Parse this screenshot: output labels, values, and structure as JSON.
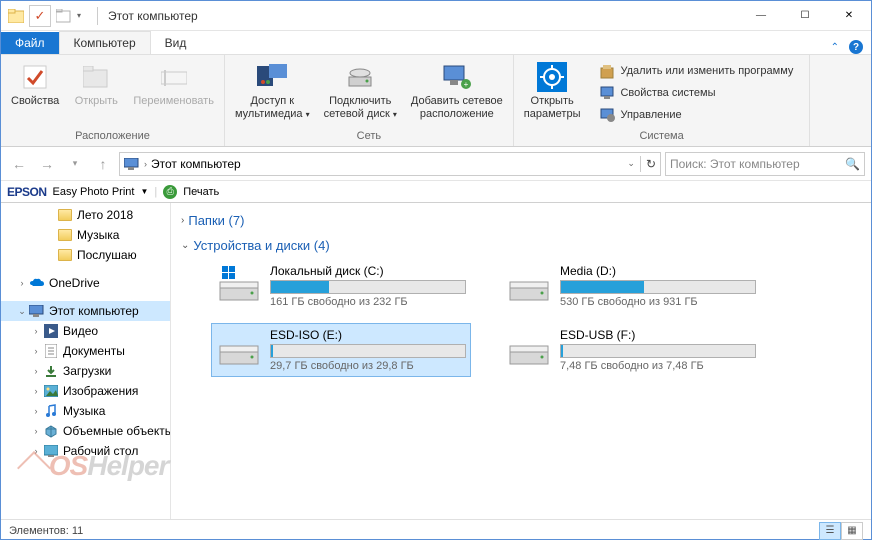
{
  "title": "Этот компьютер",
  "qat": {
    "checkmark": "✓"
  },
  "tabs": {
    "file": "Файл",
    "computer": "Компьютер",
    "view": "Вид"
  },
  "ribbon": {
    "location": {
      "label": "Расположение",
      "properties": "Свойства",
      "open": "Открыть",
      "rename": "Переименовать"
    },
    "network": {
      "label": "Сеть",
      "media": "Доступ к\nмультимедиа",
      "mapdrive": "Подключить\nсетевой диск",
      "addlocation": "Добавить сетевое\nрасположение"
    },
    "system": {
      "label": "Система",
      "settings": "Открыть\nпараметры",
      "uninstall": "Удалить или изменить программу",
      "sysprops": "Свойства системы",
      "manage": "Управление"
    }
  },
  "breadcrumb": "Этот компьютер",
  "search_placeholder": "Поиск: Этот компьютер",
  "epson": {
    "logo": "EPSON",
    "app": "Easy Photo Print",
    "print": "Печать"
  },
  "sidebar": [
    {
      "label": "Лето 2018",
      "indent": 3,
      "icon": "folder"
    },
    {
      "label": "Музыка",
      "indent": 3,
      "icon": "folder"
    },
    {
      "label": "Послушаю",
      "indent": 3,
      "icon": "folder"
    },
    {
      "label": "",
      "indent": 0,
      "blank": true
    },
    {
      "label": "OneDrive",
      "indent": 1,
      "icon": "onedrive",
      "twisty": ">"
    },
    {
      "label": "",
      "indent": 0,
      "blank": true
    },
    {
      "label": "Этот компьютер",
      "indent": 1,
      "icon": "pc",
      "twisty": "v",
      "sel": true
    },
    {
      "label": "Видео",
      "indent": 2,
      "icon": "video",
      "twisty": ">"
    },
    {
      "label": "Документы",
      "indent": 2,
      "icon": "docs",
      "twisty": ">"
    },
    {
      "label": "Загрузки",
      "indent": 2,
      "icon": "downloads",
      "twisty": ">"
    },
    {
      "label": "Изображения",
      "indent": 2,
      "icon": "images",
      "twisty": ">"
    },
    {
      "label": "Музыка",
      "indent": 2,
      "icon": "music",
      "twisty": ">"
    },
    {
      "label": "Объемные объекты",
      "indent": 2,
      "icon": "3d",
      "twisty": ">"
    },
    {
      "label": "Рабочий стол",
      "indent": 2,
      "icon": "desktop",
      "twisty": ">"
    }
  ],
  "content": {
    "folders_header": "Папки (7)",
    "drives_header": "Устройства и диски (4)",
    "drives": [
      {
        "name": "Локальный диск (C:)",
        "text": "161 ГБ свободно из 232 ГБ",
        "pct": 30,
        "os": true
      },
      {
        "name": "Media (D:)",
        "text": "530 ГБ свободно из 931 ГБ",
        "pct": 43
      },
      {
        "name": "ESD-ISO (E:)",
        "text": "29,7 ГБ свободно из 29,8 ГБ",
        "pct": 1,
        "sel": true
      },
      {
        "name": "ESD-USB (F:)",
        "text": "7,48 ГБ свободно из 7,48 ГБ",
        "pct": 1
      }
    ]
  },
  "status": "Элементов: 11",
  "watermark": {
    "a": "OS",
    "b": "Helper"
  }
}
